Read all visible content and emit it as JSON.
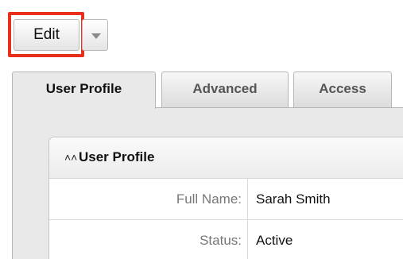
{
  "toolbar": {
    "edit_label": "Edit",
    "dropdown_icon": "caret-down-icon",
    "highlight_color": "#e8301c"
  },
  "tabs": [
    {
      "label": "User Profile",
      "active": true
    },
    {
      "label": "Advanced",
      "active": false
    },
    {
      "label": "Access",
      "active": false
    }
  ],
  "panel": {
    "collapse_icon": "double-chevron-up-icon",
    "title": "User Profile",
    "fields": [
      {
        "label": "Full Name:",
        "value": "Sarah Smith"
      },
      {
        "label": "Status:",
        "value": "Active"
      }
    ]
  }
}
